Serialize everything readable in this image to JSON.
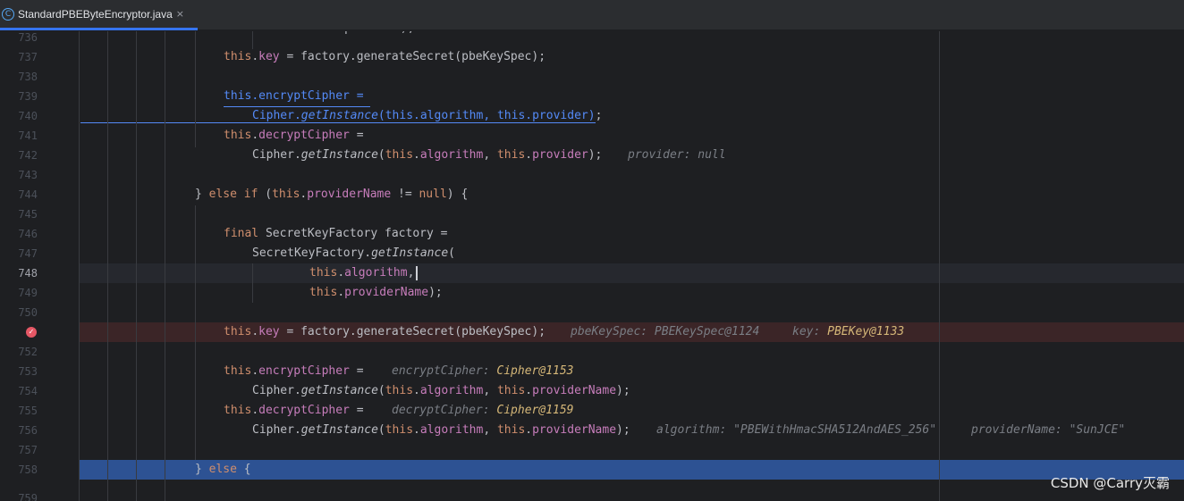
{
  "tab": {
    "icon": "class-icon",
    "icon_glyph": "C",
    "label": "StandardPBEByteEncryptor.java",
    "close": "×"
  },
  "colors": {
    "editor_bg": "#1e1f22",
    "current_line_bg": "#26282e",
    "breakpoint_line_bg": "#3b2527",
    "selected_line_bg": "#2d5293",
    "keyword": "#cf8e6d",
    "field": "#c77dbb",
    "inline_hint": "#7a7e85",
    "link": "#548af7"
  },
  "line_numbers": [
    "736",
    "737",
    "738",
    "739",
    "740",
    "741",
    "742",
    "743",
    "744",
    "745",
    "746",
    "747",
    "748",
    "749",
    "750",
    "",
    "752",
    "753",
    "754",
    "755",
    "756",
    "757",
    "758",
    "759"
  ],
  "breakpoint_icon": "breakpoint-icon",
  "code": {
    "l736_clip": "this.provider);",
    "l737": {
      "a": "this",
      "b": ".",
      "c": "key",
      "d": " = factory.generateSecret(pbeKeySpec);"
    },
    "l739": {
      "a": "this",
      "b": ".",
      "c": "encryptCipher",
      "d": " = "
    },
    "l740": {
      "a": "Cipher.",
      "b": "getInstance",
      "c": "(",
      "d": "this",
      "e": ".",
      "f": "algorithm",
      "g": ", ",
      "h": "this",
      "i": ".",
      "j": "provider",
      "k": ")",
      "l": ";"
    },
    "l741": {
      "a": "this",
      "b": ".",
      "c": "decryptCipher",
      "d": " ="
    },
    "l742": {
      "a": "Cipher.",
      "b": "getInstance",
      "c": "(",
      "d": "this",
      "e": ".",
      "f": "algorithm",
      "g": ", ",
      "h": "this",
      "i": ".",
      "j": "provider",
      "k": ");",
      "hint_name": "provider: ",
      "hint_val": "null"
    },
    "l744": {
      "a": "} ",
      "b": "else if",
      "c": " (",
      "d": "this",
      "e": ".",
      "f": "providerName",
      "g": " != ",
      "h": "null",
      "i": ") {"
    },
    "l746": {
      "a": "final",
      "b": " SecretKeyFactory factory ="
    },
    "l747": {
      "a": "SecretKeyFactory.",
      "b": "getInstance",
      "c": "("
    },
    "l748": {
      "a": "this",
      "b": ".",
      "c": "algorithm",
      "d": ","
    },
    "l749": {
      "a": "this",
      "b": ".",
      "c": "providerName",
      "d": ");"
    },
    "l751": {
      "a": "this",
      "b": ".",
      "c": "key",
      "d": " = factory.generateSecret(pbeKeySpec);",
      "hint1_name": "pbeKeySpec: ",
      "hint1_val": "PBEKeySpec@1124",
      "hint2_name": "key: ",
      "hint2_val": "PBEKey@1133"
    },
    "l753": {
      "a": "this",
      "b": ".",
      "c": "encryptCipher",
      "d": " =",
      "hint_name": "encryptCipher: ",
      "hint_val": "Cipher@1153"
    },
    "l754": {
      "a": "Cipher.",
      "b": "getInstance",
      "c": "(",
      "d": "this",
      "e": ".",
      "f": "algorithm",
      "g": ", ",
      "h": "this",
      "i": ".",
      "j": "providerName",
      "k": ");"
    },
    "l755": {
      "a": "this",
      "b": ".",
      "c": "decryptCipher",
      "d": " =",
      "hint_name": "decryptCipher: ",
      "hint_val": "Cipher@1159"
    },
    "l756": {
      "a": "Cipher.",
      "b": "getInstance",
      "c": "(",
      "d": "this",
      "e": ".",
      "f": "algorithm",
      "g": ", ",
      "h": "this",
      "i": ".",
      "j": "providerName",
      "k": ");",
      "hint1_name": "algorithm: ",
      "hint1_val": "\"PBEWithHmacSHA512AndAES_256\"",
      "hint2_name": "providerName: ",
      "hint2_val": "\"SunJCE\""
    },
    "l758": {
      "a": "} ",
      "b": "else",
      "c": " {"
    }
  },
  "watermark": "CSDN @Carry灭霸"
}
